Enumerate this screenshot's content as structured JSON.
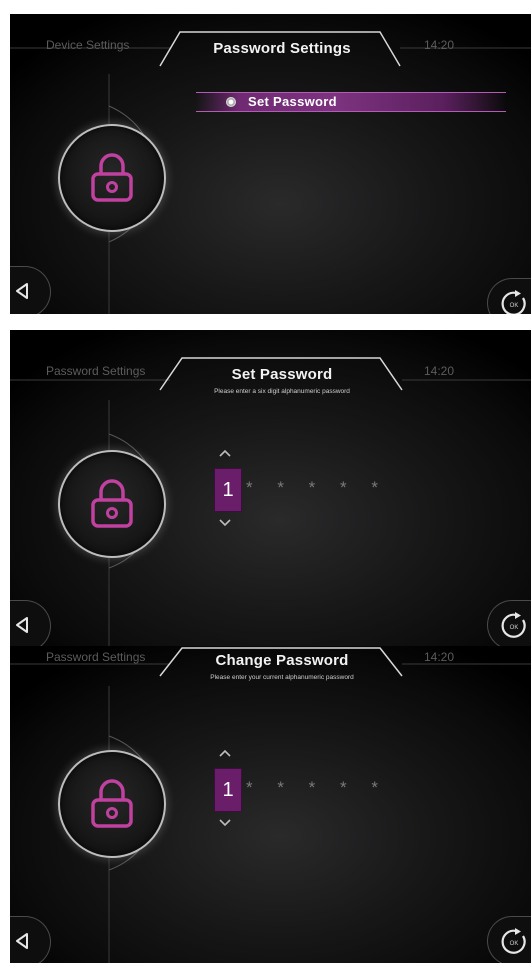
{
  "screens": [
    {
      "breadcrumb": "Device Settings",
      "title": "Password Settings",
      "time": "14:20",
      "menu": {
        "selected_item": "Set Password"
      }
    },
    {
      "breadcrumb": "Password Settings",
      "title": "Set Password",
      "subtitle": "Please enter a six digit alphanumeric password",
      "time": "14:20",
      "password": {
        "current_digit": "1",
        "mask": "* * * * *"
      }
    },
    {
      "breadcrumb": "Password Settings",
      "title": "Change Password",
      "subtitle": "Please enter your current alphanumeric password",
      "time": "14:20",
      "password": {
        "current_digit": "1",
        "mask": "* * * * *"
      }
    }
  ],
  "icons": {
    "lock": "lock-icon",
    "back": "back-arrow-icon",
    "ok": "ok-refresh-icon",
    "up": "chevron-up-icon",
    "down": "chevron-down-icon"
  },
  "colors": {
    "accent": "#7d3380",
    "accent_border": "#b25cb5",
    "lock_icon": "#c0419f",
    "text_muted": "#5c5c5c"
  }
}
